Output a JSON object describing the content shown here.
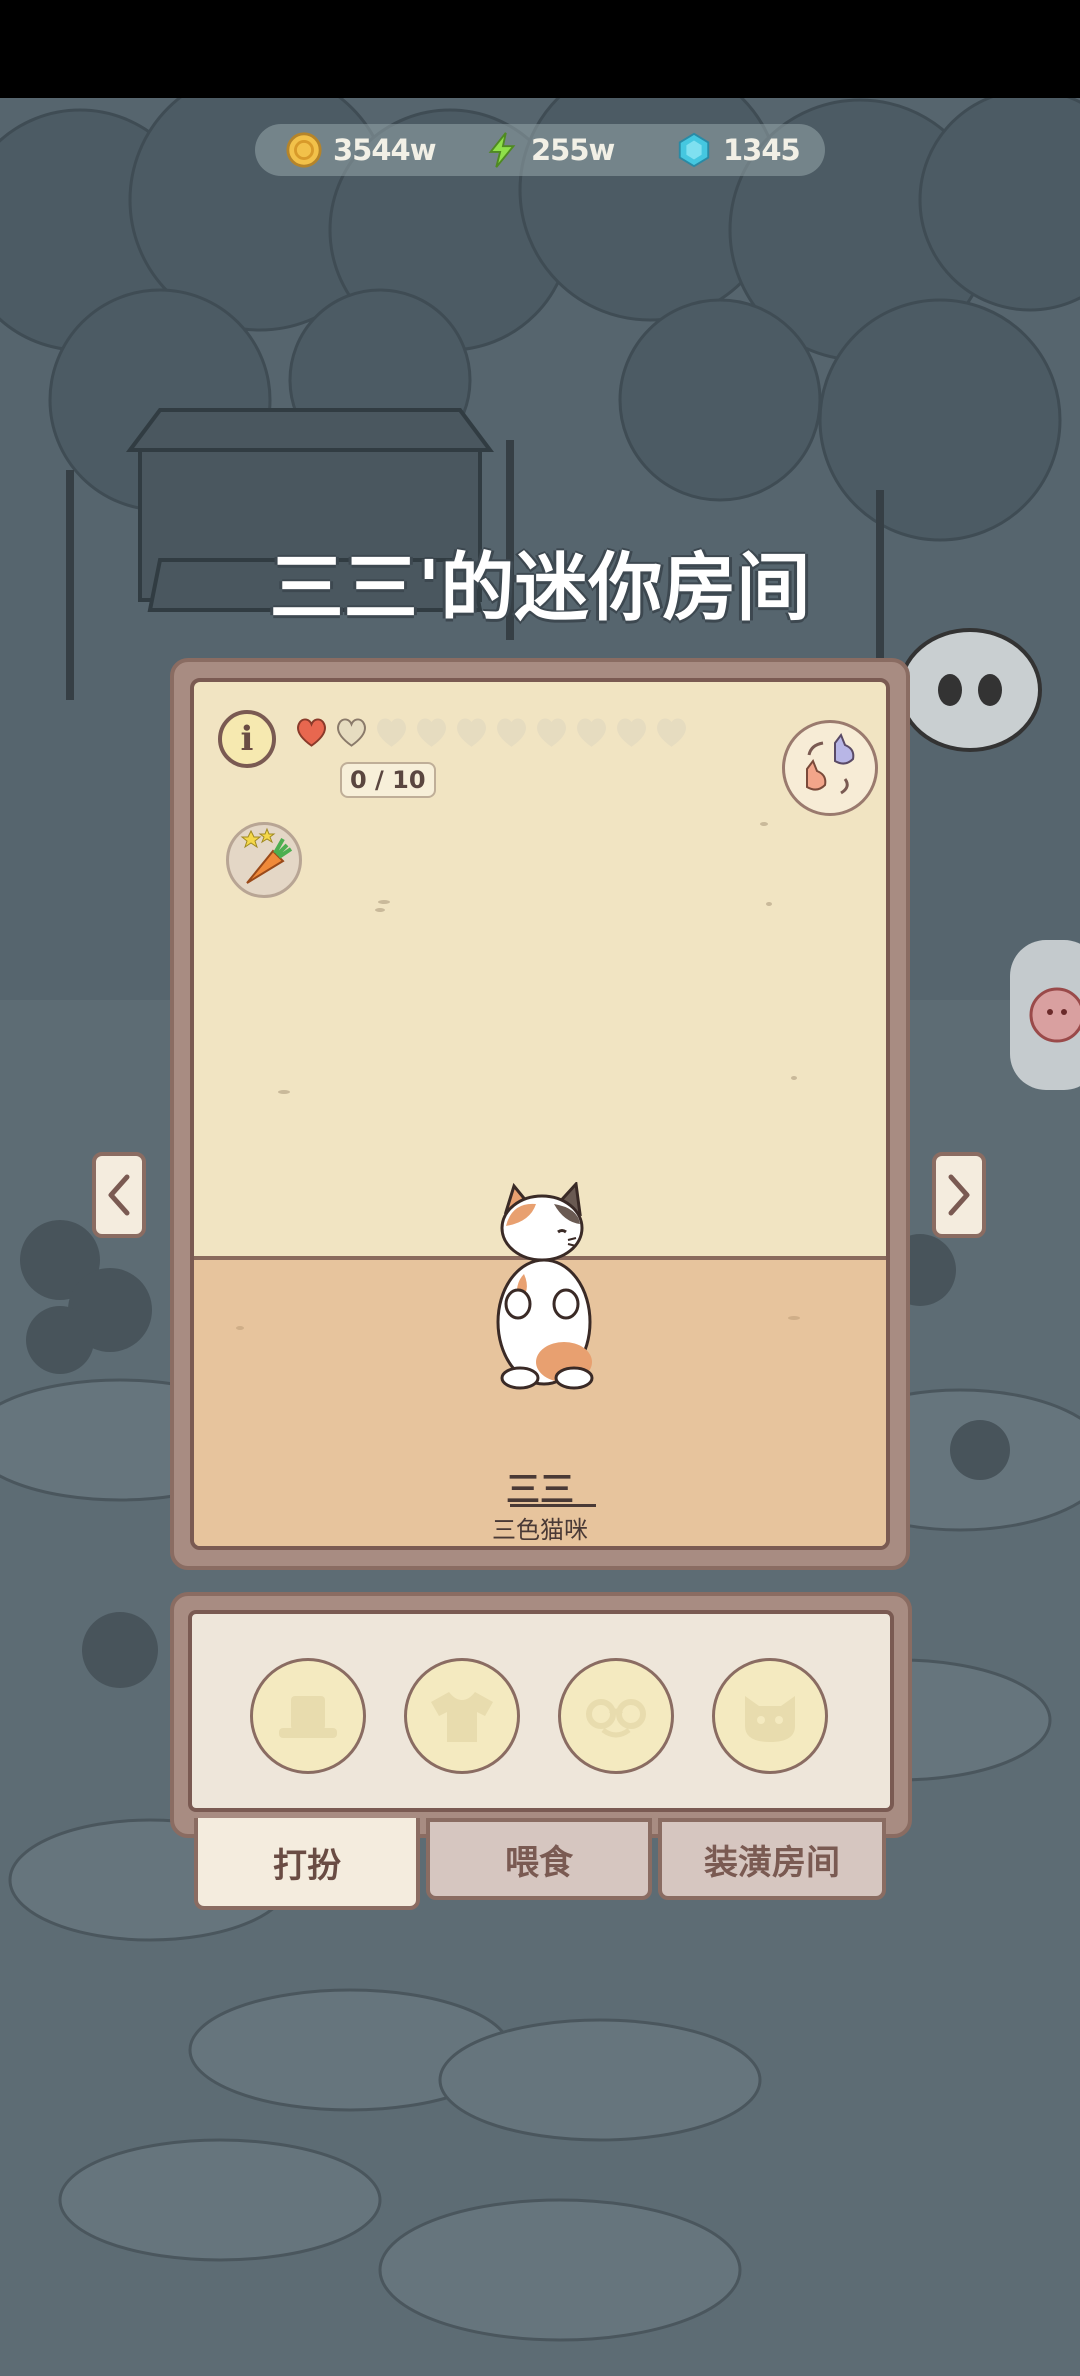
{
  "resources": {
    "coins": "3544w",
    "energy": "255w",
    "gems": "1345"
  },
  "title": "三三'的迷你房间",
  "room": {
    "hearts_filled": 1,
    "hearts_total": 10,
    "hearts_count_text": "0 / 10",
    "pet_name": "三三",
    "pet_species": "三色猫咪"
  },
  "tabs": {
    "dress": "打扮",
    "feed": "喂食",
    "decorate": "装潢房间"
  },
  "icons": {
    "coin": "coin-icon",
    "energy": "lightning-icon",
    "gem": "gem-icon",
    "info": "info-icon",
    "swap": "cat-swap-icon",
    "carrot": "carrot-icon",
    "hat": "hat-icon",
    "shirt": "shirt-icon",
    "glasses": "glasses-icon",
    "face": "cat-face-icon"
  },
  "colors": {
    "heart_filled": "#e8674f",
    "heart_empty": "#e6dcc0",
    "room_wall": "#f1e4c2",
    "room_floor": "#e7c49d",
    "frame": "#a88c82"
  }
}
